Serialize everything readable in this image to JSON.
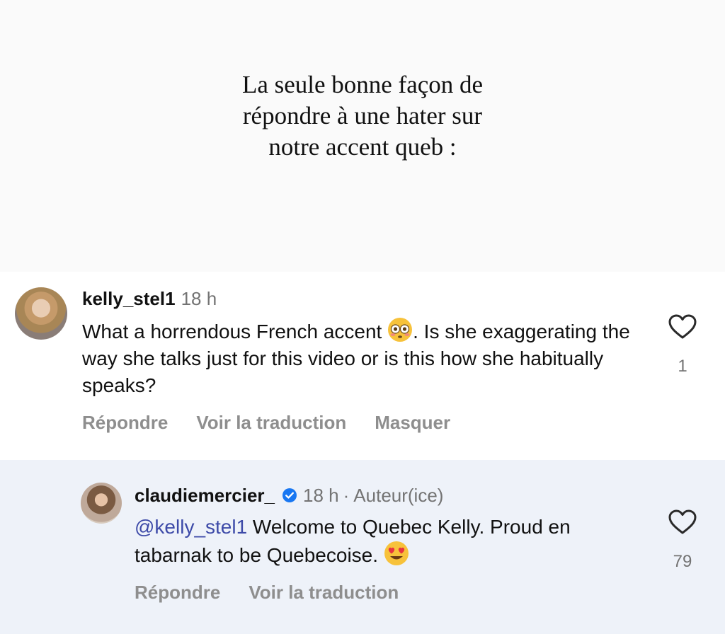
{
  "post": {
    "caption_lines": [
      "La seule bonne façon de",
      "répondre à une hater sur",
      "notre accent queb :"
    ]
  },
  "comments": [
    {
      "username": "kelly_stel1",
      "time": "18 h",
      "text_before_emoji": "What a horrendous French accent ",
      "emoji": "flushed-face",
      "text_after_emoji": ". Is she exaggerating the way she talks just for this video or is this how she habitually speaks?",
      "actions": [
        "Répondre",
        "Voir la traduction",
        "Masquer"
      ],
      "likes": "1"
    },
    {
      "username": "claudiemercier_",
      "verified": true,
      "time": "18 h",
      "separator": "·",
      "author_badge": "Auteur(ice)",
      "mention": "@kelly_stel1",
      "text": " Welcome to Quebec Kelly. Proud en tabarnak to be Quebecoise. ",
      "emoji": "heart-eyes-face",
      "actions": [
        "Répondre",
        "Voir la traduction"
      ],
      "likes": "79"
    }
  ],
  "colors": {
    "caption_bg": "#fafafa",
    "reply_bg": "#eef2f9",
    "mention": "#3d4aa8",
    "muted": "#8e8e8e",
    "verified": "#1877f2"
  }
}
